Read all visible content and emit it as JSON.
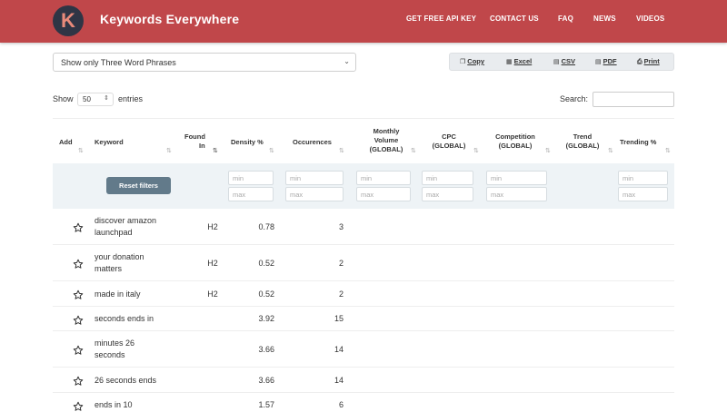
{
  "header": {
    "logo_letter": "K",
    "brand": "Keywords Everywhere",
    "nav": [
      "GET FREE API KEY",
      "CONTACT US",
      "FAQ",
      "NEWS",
      "VIDEOS"
    ]
  },
  "colors": {
    "header_bg": "#c0474a",
    "reset_button": "#627a8a",
    "filter_row_bg": "#eef3f6"
  },
  "phrase_filter": {
    "selected": "Show only Three Word Phrases"
  },
  "export": {
    "copy": "Copy",
    "excel": "Excel",
    "csv": "CSV",
    "pdf": "PDF",
    "print": "Print"
  },
  "length_menu": {
    "show": "Show",
    "value": "50",
    "entries": "entries"
  },
  "search": {
    "label": "Search:"
  },
  "columns": {
    "add": "Add",
    "keyword": "Keyword",
    "found_in_1": "Found",
    "found_in_2": "In",
    "density": "Density %",
    "occurences": "Occurences",
    "volume_1": "Monthly",
    "volume_2": "Volume",
    "volume_3": "(GLOBAL)",
    "cpc_1": "CPC",
    "cpc_2": "(GLOBAL)",
    "comp_1": "Competition",
    "comp_2": "(GLOBAL)",
    "trend_1": "Trend",
    "trend_2": "(GLOBAL)",
    "trending": "Trending %"
  },
  "filters": {
    "reset_label": "Reset filters",
    "min": "min",
    "max": "max"
  },
  "rows": [
    {
      "kw1": "discover amazon",
      "kw2": "launchpad",
      "found": "H2",
      "density": "0.78",
      "occ": "3"
    },
    {
      "kw1": "your donation",
      "kw2": "matters",
      "found": "H2",
      "density": "0.52",
      "occ": "2"
    },
    {
      "kw1": "made in italy",
      "kw2": "",
      "found": "H2",
      "density": "0.52",
      "occ": "2"
    },
    {
      "kw1": "seconds ends in",
      "kw2": "",
      "found": "",
      "density": "3.92",
      "occ": "15"
    },
    {
      "kw1": "minutes 26",
      "kw2": "seconds",
      "found": "",
      "density": "3.66",
      "occ": "14"
    },
    {
      "kw1": "26 seconds ends",
      "kw2": "",
      "found": "",
      "density": "3.66",
      "occ": "14"
    },
    {
      "kw1": "ends in 10",
      "kw2": "",
      "found": "",
      "density": "1.57",
      "occ": "6"
    }
  ]
}
